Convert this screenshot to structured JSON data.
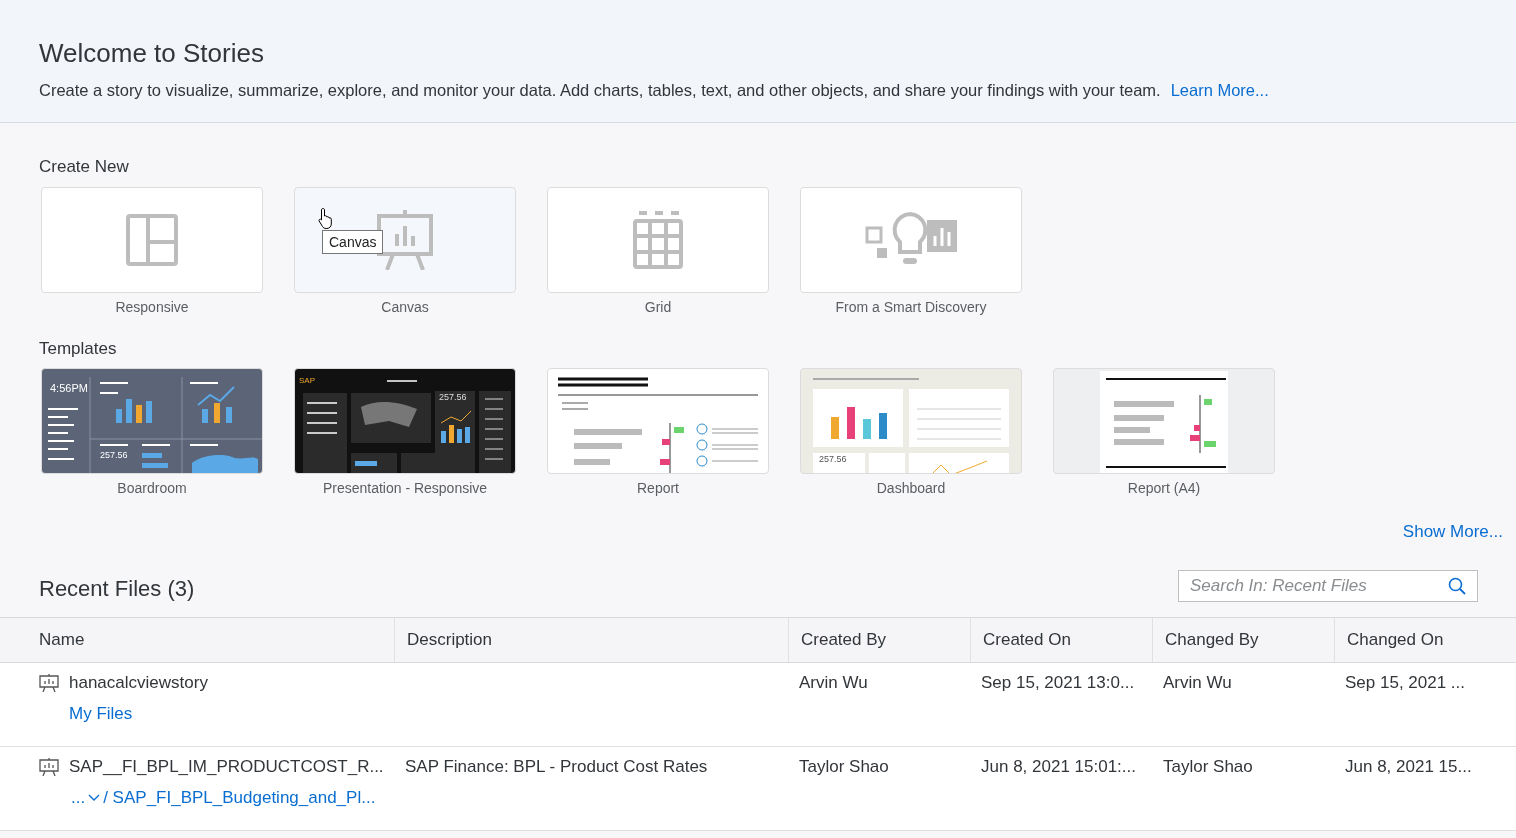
{
  "header": {
    "title": "Welcome to Stories",
    "description": "Create a story to visualize, summarize, explore, and monitor your data. Add charts, tables, text, and other objects, and share your findings with your team.",
    "link": "Learn More..."
  },
  "create_new": {
    "heading": "Create New",
    "items": [
      {
        "label": "Responsive",
        "kind": "responsive",
        "hovered": false
      },
      {
        "label": "Canvas",
        "kind": "canvas",
        "hovered": true
      },
      {
        "label": "Grid",
        "kind": "grid",
        "hovered": false
      },
      {
        "label": "From a Smart Discovery",
        "kind": "discovery",
        "hovered": false
      }
    ]
  },
  "tooltip": "Canvas",
  "templates": {
    "heading": "Templates",
    "items": [
      {
        "label": "Boardroom",
        "kind": "boardroom",
        "texts": [
          "4:56PM",
          "257.56"
        ]
      },
      {
        "label": "Presentation - Responsive",
        "kind": "presentation",
        "texts": [
          "SAP",
          "257.56"
        ]
      },
      {
        "label": "Report",
        "kind": "report"
      },
      {
        "label": "Dashboard",
        "kind": "dashboard",
        "texts": [
          "257.56"
        ]
      },
      {
        "label": "Report (A4)",
        "kind": "a4"
      }
    ],
    "show_more": "Show More..."
  },
  "recent_files": {
    "title": "Recent Files (3)",
    "search": {
      "placeholder": "Search In: Recent Files"
    },
    "columns": [
      "Name",
      "Description",
      "Created By",
      "Created On",
      "Changed By",
      "Changed On"
    ],
    "rows": [
      {
        "name": "hanacalcviewstory",
        "path": "My Files",
        "created_by": "Arvin Wu",
        "created_on": "Sep 15, 2021 13:0...",
        "changed_by": "Arvin Wu",
        "changed_on": "Sep 15, 2021 ..."
      },
      {
        "name": "SAP__FI_BPL_IM_PRODUCTCOST_R...",
        "ellipsis": "...",
        "path": "/ SAP_FI_BPL_Budgeting_and_Pl...",
        "description": "SAP Finance: BPL - Product Cost Rates",
        "created_by": "Taylor Shao",
        "created_on": "Jun 8, 2021 15:01:...",
        "changed_by": "Taylor Shao",
        "changed_on": "Jun 8, 2021 15..."
      }
    ]
  }
}
